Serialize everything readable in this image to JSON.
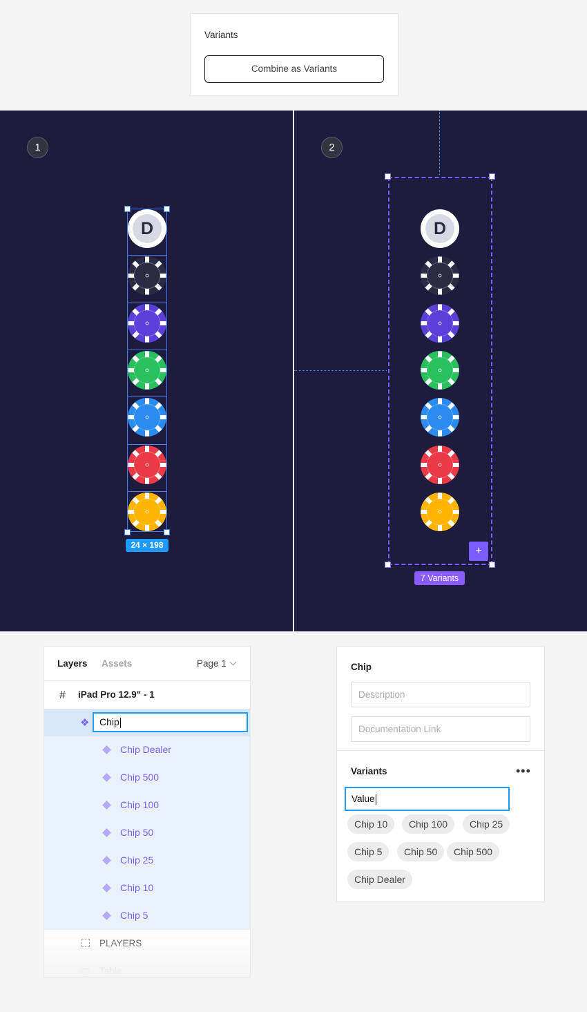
{
  "variants_card": {
    "title": "Variants",
    "combine_button": "Combine as Variants"
  },
  "canvas_left": {
    "step": "1",
    "size_badge": "24 × 198"
  },
  "canvas_right": {
    "step": "2",
    "plus_icon": "plus-icon",
    "variants_badge": "7 Variants"
  },
  "chips": [
    {
      "name": "Chip Dealer",
      "kind": "dealer",
      "color": "#ffffff",
      "letter": "D"
    },
    {
      "name": "Chip 500",
      "kind": "chip",
      "color": "#2c2b45"
    },
    {
      "name": "Chip 100",
      "kind": "chip",
      "color": "#5b3fd9"
    },
    {
      "name": "Chip 50",
      "kind": "chip",
      "color": "#28c15e"
    },
    {
      "name": "Chip 25",
      "kind": "chip",
      "color": "#2b8cf0"
    },
    {
      "name": "Chip 10",
      "kind": "chip",
      "color": "#ea3a48"
    },
    {
      "name": "Chip 5",
      "kind": "chip",
      "color": "#ffb400"
    }
  ],
  "layers_panel": {
    "tab_layers": "Layers",
    "tab_assets": "Assets",
    "page": "Page 1",
    "frame_icon": "#",
    "frame_name": "iPad Pro 12.9\" - 1",
    "component_set_name": "Chip",
    "variants": [
      {
        "label": "Chip Dealer"
      },
      {
        "label": "Chip 500"
      },
      {
        "label": "Chip 100"
      },
      {
        "label": "Chip 50"
      },
      {
        "label": "Chip 25"
      },
      {
        "label": "Chip 10"
      },
      {
        "label": "Chip 5"
      }
    ],
    "players_label": "PLAYERS",
    "table_label": "Table"
  },
  "properties_panel": {
    "component_name": "Chip",
    "description_placeholder": "Description",
    "documentation_placeholder": "Documentation Link",
    "variants_title": "Variants",
    "more_icon": "•••",
    "property_value": "Value",
    "pills": [
      "Chip 10",
      "Chip 100",
      "Chip 25",
      "Chip 5",
      "Chip 50",
      "Chip 500",
      "Chip Dealer"
    ]
  },
  "colors": {
    "canvas_bg": "#1e1c3e",
    "selection_blue": "#2e86ff",
    "variant_purple": "#7a5cff",
    "focus_blue": "#1d9bf0"
  }
}
